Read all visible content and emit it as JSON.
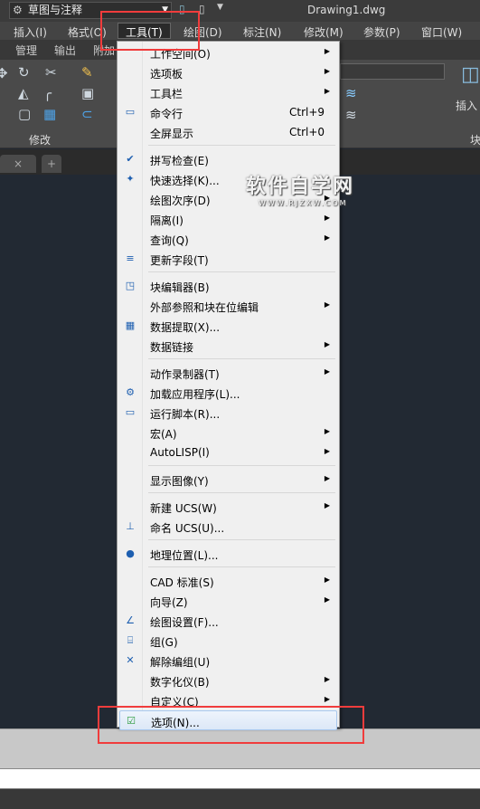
{
  "titlebar": {
    "workspace": "草图与注释",
    "document": "Drawing1.dwg"
  },
  "menubar": [
    {
      "label": "插入(I)"
    },
    {
      "label": "格式(O)"
    },
    {
      "label": "工具(T)",
      "active": true
    },
    {
      "label": "绘图(D)"
    },
    {
      "label": "标注(N)"
    },
    {
      "label": "修改(M)"
    },
    {
      "label": "参数(P)"
    },
    {
      "label": "窗口(W)"
    }
  ],
  "ribbon_tabs": [
    "管理",
    "输出",
    "附加"
  ],
  "ribbon": {
    "modify_panel": "修改",
    "insert_button": "插入",
    "block_panel": "块"
  },
  "watermark": {
    "text": "软件自学网",
    "sub": "WWW.RJZXW.COM"
  },
  "tools_menu": [
    {
      "label": "工作空间(O)",
      "submenu": true
    },
    {
      "label": "选项板",
      "submenu": true
    },
    {
      "label": "工具栏",
      "submenu": true
    },
    {
      "label": "命令行",
      "shortcut": "Ctrl+9",
      "icon": "command-line-icon"
    },
    {
      "label": "全屏显示",
      "shortcut": "Ctrl+0"
    },
    {
      "sep": true
    },
    {
      "label": "拼写检查(E)",
      "icon": "spell-check-icon"
    },
    {
      "label": "快速选择(K)...",
      "icon": "quick-select-icon"
    },
    {
      "label": "绘图次序(D)",
      "submenu": true
    },
    {
      "label": "隔离(I)",
      "submenu": true
    },
    {
      "label": "查询(Q)",
      "submenu": true
    },
    {
      "label": "更新字段(T)",
      "icon": "update-field-icon"
    },
    {
      "sep": true
    },
    {
      "label": "块编辑器(B)",
      "icon": "block-editor-icon"
    },
    {
      "label": "外部参照和块在位编辑",
      "submenu": true
    },
    {
      "label": "数据提取(X)...",
      "icon": "data-extraction-icon"
    },
    {
      "label": "数据链接",
      "submenu": true
    },
    {
      "sep": true
    },
    {
      "label": "动作录制器(T)",
      "submenu": true
    },
    {
      "label": "加载应用程序(L)...",
      "icon": "load-application-icon"
    },
    {
      "label": "运行脚本(R)...",
      "icon": "run-script-icon"
    },
    {
      "label": "宏(A)",
      "submenu": true
    },
    {
      "label": "AutoLISP(I)",
      "submenu": true
    },
    {
      "sep": true
    },
    {
      "label": "显示图像(Y)",
      "submenu": true
    },
    {
      "sep": true
    },
    {
      "label": "新建 UCS(W)",
      "submenu": true
    },
    {
      "label": "命名 UCS(U)...",
      "icon": "named-ucs-icon"
    },
    {
      "sep": true
    },
    {
      "label": "地理位置(L)...",
      "icon": "globe-icon"
    },
    {
      "sep": true
    },
    {
      "label": "CAD 标准(S)",
      "submenu": true
    },
    {
      "label": "向导(Z)",
      "submenu": true
    },
    {
      "label": "绘图设置(F)...",
      "icon": "drafting-settings-icon"
    },
    {
      "label": "组(G)",
      "icon": "group-icon"
    },
    {
      "label": "解除编组(U)",
      "icon": "ungroup-icon"
    },
    {
      "label": "数字化仪(B)",
      "submenu": true
    },
    {
      "label": "自定义(C)",
      "submenu": true
    },
    {
      "label": "选项(N)...",
      "icon": "options-check-icon",
      "highlighted": true
    }
  ]
}
